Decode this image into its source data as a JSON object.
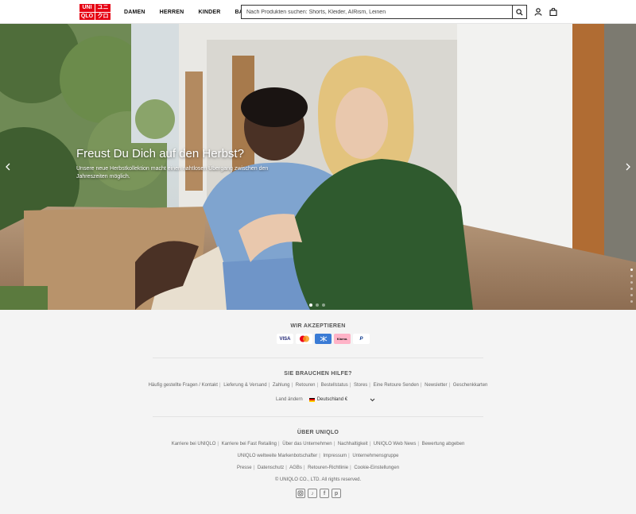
{
  "header": {
    "logo": [
      "UNI",
      "ユニ",
      "QLO",
      "クロ"
    ],
    "nav": [
      "DAMEN",
      "HERREN",
      "KINDER",
      "BABYS"
    ],
    "search_placeholder": "Nach Produkten suchen: Shorts, Kleider, AIRism, Leinen",
    "icons": [
      "search-icon",
      "account-icon",
      "cart-icon"
    ]
  },
  "hero": {
    "title": "Freust Du Dich auf den Herbst?",
    "subtitle": "Unsere neue Herbstkollektion macht einen nahtlosen Übergang zwischen den Jahreszeiten möglich.",
    "slide_index": 1,
    "slide_count": 6
  },
  "footer": {
    "payments_title": "WIR AKZEPTIEREN",
    "payments": [
      "VISA",
      "Mastercard",
      "Sofort",
      "Klarna.",
      "PayPal"
    ],
    "help_title": "SIE BRAUCHEN HILFE?",
    "help_links": [
      "Häufig gestellte Fragen / Kontakt",
      "Lieferung & Versand",
      "Zahlung",
      "Retouren",
      "Bestellstatus",
      "Stores",
      "Eine Retoure Senden",
      "Newsletter",
      "Geschenkkarten"
    ],
    "country_label": "Land ändern",
    "country_value": "Deutschland €",
    "about_title": "ÜBER UNIQLO",
    "about_links_1": [
      "Karriere bei UNIQLO",
      "Karriere bei Fast Retailing",
      "Über das Unternehmen",
      "Nachhaltigkeit",
      "UNIQLO Web News",
      "Bewertung abgeben"
    ],
    "about_links_2": [
      "UNIQLO weltweite Markenbotschafter",
      "Impressum",
      "Unternehmensgruppe"
    ],
    "about_links_3": [
      "Presse",
      "Datenschutz",
      "AGBs",
      "Retouren-Richtlinie",
      "Cookie-Einstellungen"
    ],
    "copyright": "© UNIQLO CO., LTD. All rights reserved.",
    "social": [
      "instagram-icon",
      "tiktok-icon",
      "facebook-icon",
      "pinterest-icon"
    ]
  },
  "colors": {
    "brand": "#e60012",
    "sweater_green": "#2f5a2e",
    "sweater_blue": "#6f95c8"
  }
}
